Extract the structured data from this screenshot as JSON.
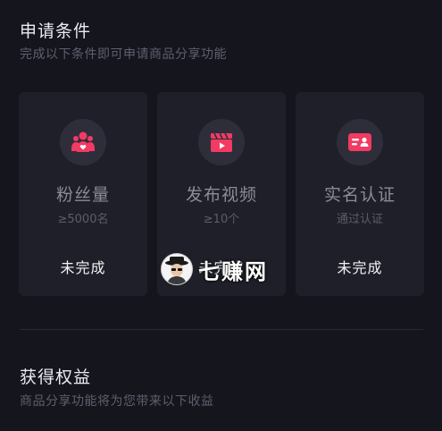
{
  "section_conditions": {
    "title": "申请条件",
    "subtitle": "完成以下条件即可申请商品分享功能"
  },
  "cards": [
    {
      "icon": "fans-icon",
      "title": "粉丝量",
      "requirement": "≥5000名",
      "status": "未完成"
    },
    {
      "icon": "video-icon",
      "title": "发布视频",
      "requirement": "≥10个",
      "status": "未完成"
    },
    {
      "icon": "id-card-icon",
      "title": "实名认证",
      "requirement": "通过认证",
      "status": "未完成"
    }
  ],
  "section_benefits": {
    "title": "获得权益",
    "subtitle": "商品分享功能将为您带来以下收益"
  },
  "watermark": {
    "text": "七赚网"
  },
  "colors": {
    "background": "#15151e",
    "card": "#1f1f29",
    "icon_circle": "#2e2e3b",
    "accent": "#f23a63"
  }
}
